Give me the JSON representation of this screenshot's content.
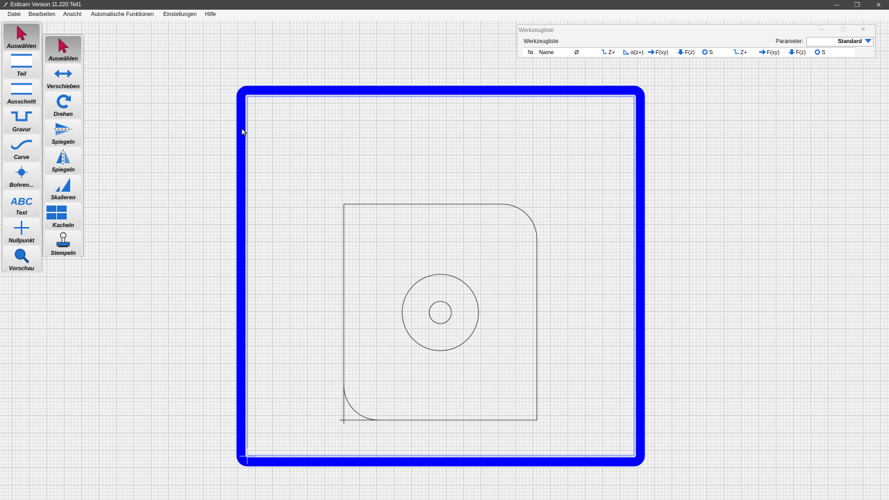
{
  "window": {
    "title": "Estlcam Version 11,220 Teil1",
    "minimize": "─",
    "maximize": "❐",
    "close": "✕"
  },
  "menu": [
    "Datei",
    "Bearbeiten",
    "Ansicht",
    "Automatische Funktionen",
    "Einstellungen",
    "Hilfe"
  ],
  "left_toolbar": [
    {
      "label": "Auswählen",
      "icon": "pointer-arrow-icon",
      "active": true
    },
    {
      "label": "Teil",
      "icon": "part-outline-icon"
    },
    {
      "label": "Ausschnitt",
      "icon": "pocket-icon"
    },
    {
      "label": "Gravur",
      "icon": "engrave-icon"
    },
    {
      "label": "Carve",
      "icon": "carve-icon"
    },
    {
      "label": "Bohren...",
      "icon": "drill-icon"
    },
    {
      "label": "Text",
      "icon": "text-abc-icon"
    },
    {
      "label": "Nullpunkt",
      "icon": "origin-cross-icon"
    },
    {
      "label": "Vorschau",
      "icon": "magnifier-icon"
    }
  ],
  "right_toolbar": [
    {
      "label": "Auswählen",
      "icon": "pointer-arrow-icon",
      "active": true
    },
    {
      "label": "Verschieben",
      "icon": "move-arrows-icon"
    },
    {
      "label": "Drehen",
      "icon": "rotate-icon"
    },
    {
      "label": "Spiegeln",
      "icon": "mirror-horizontal-icon"
    },
    {
      "label": "Spiegeln",
      "icon": "mirror-vertical-icon"
    },
    {
      "label": "Skalieren",
      "icon": "scale-icon"
    },
    {
      "label": "Kacheln",
      "icon": "tiles-icon"
    },
    {
      "label": "Stempeln",
      "icon": "stamp-icon"
    }
  ],
  "tool_panel": {
    "window_title": "Werkzeugliste",
    "subtitle": "Werkzeugliste",
    "parameter_label": "Parameter:",
    "parameter_value": "Standard",
    "columns": [
      "Nr.",
      "Name",
      "Ø",
      "Z+",
      "α(z+)",
      "F(xy)",
      "F(z)",
      "S",
      "Z+",
      "F(xy)",
      "F(z)",
      "S"
    ]
  },
  "colors": {
    "accent_blue": "#0000ff",
    "active_red": "#c8104a",
    "icon_blue": "#1f6fd0"
  }
}
